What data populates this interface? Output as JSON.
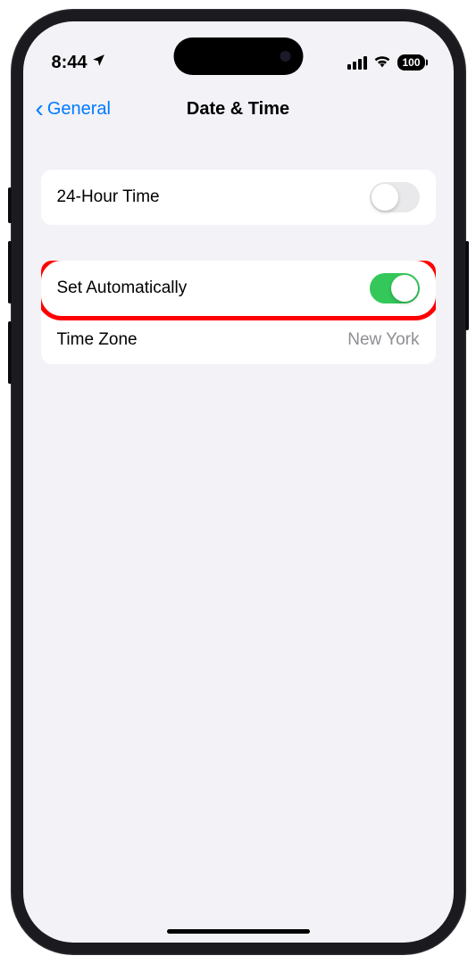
{
  "statusBar": {
    "time": "8:44",
    "batteryLevel": "100"
  },
  "navBar": {
    "backLabel": "General",
    "title": "Date & Time"
  },
  "settings": {
    "group1": {
      "row1": {
        "label": "24-Hour Time",
        "toggleState": "off"
      }
    },
    "group2": {
      "row1": {
        "label": "Set Automatically",
        "toggleState": "on"
      },
      "row2": {
        "label": "Time Zone",
        "value": "New York"
      }
    }
  }
}
